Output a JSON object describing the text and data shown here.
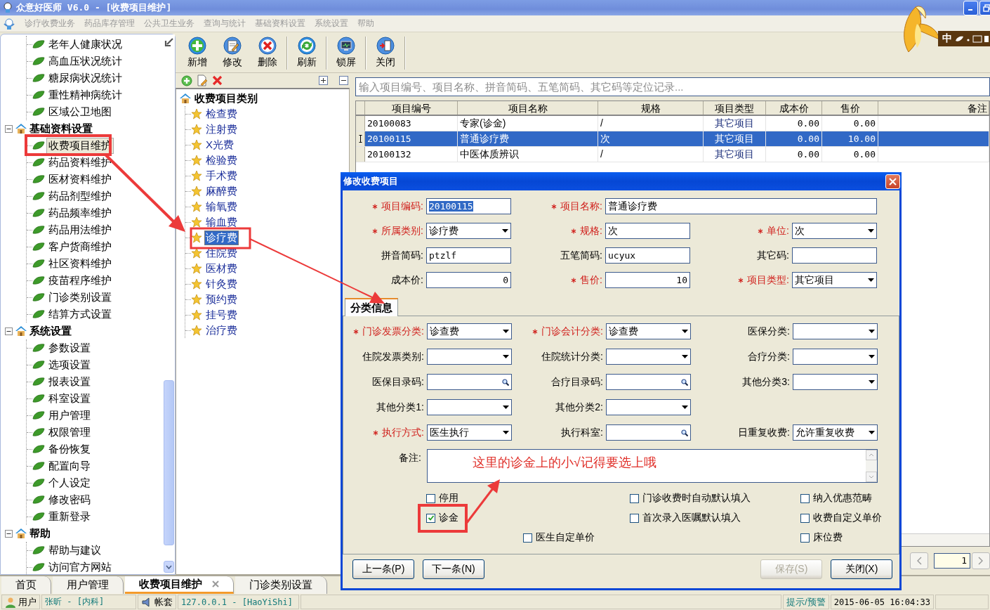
{
  "window": {
    "title": "众意好医师 V6.0 - [收费项目维护]"
  },
  "menu": [
    {
      "label": "诊疗收费业务",
      "disabled": true
    },
    {
      "label": "药品库存管理",
      "disabled": true
    },
    {
      "label": "公共卫生业务",
      "disabled": true
    },
    {
      "label": "查询与统计",
      "disabled": true
    },
    {
      "label": "基础资料设置",
      "disabled": true
    },
    {
      "label": "系统设置",
      "disabled": true
    },
    {
      "label": "帮助",
      "disabled": true
    }
  ],
  "ime": {
    "label": "中"
  },
  "nav_tree": {
    "items": [
      {
        "label": "老年人健康状况",
        "selected": false
      },
      {
        "label": "高血压状况统计",
        "selected": false
      },
      {
        "label": "糖尿病状况统计",
        "selected": false
      },
      {
        "label": "重性精神病统计",
        "selected": false
      },
      {
        "label": "区域公卫地图",
        "selected": false
      }
    ],
    "groups": [
      {
        "label": "基础资料设置",
        "expanded": true,
        "children": [
          {
            "label": "收费项目维护",
            "selected": true
          },
          {
            "label": "药品资料维护",
            "selected": false
          },
          {
            "label": "医材资料维护",
            "selected": false
          },
          {
            "label": "药品剂型维护",
            "selected": false
          },
          {
            "label": "药品频率维护",
            "selected": false
          },
          {
            "label": "药品用法维护",
            "selected": false
          },
          {
            "label": "客户货商维护",
            "selected": false
          },
          {
            "label": "社区资料维护",
            "selected": false
          },
          {
            "label": "疫苗程序维护",
            "selected": false
          },
          {
            "label": "门诊类别设置",
            "selected": false
          },
          {
            "label": "结算方式设置",
            "selected": false
          }
        ]
      },
      {
        "label": "系统设置",
        "expanded": true,
        "children": [
          {
            "label": "参数设置",
            "selected": false
          },
          {
            "label": "选项设置",
            "selected": false
          },
          {
            "label": "报表设置",
            "selected": false
          },
          {
            "label": "科室设置",
            "selected": false
          },
          {
            "label": "用户管理",
            "selected": false
          },
          {
            "label": "权限管理",
            "selected": false
          },
          {
            "label": "备份恢复",
            "selected": false
          },
          {
            "label": "配置向导",
            "selected": false
          },
          {
            "label": "个人设定",
            "selected": false
          },
          {
            "label": "修改密码",
            "selected": false
          },
          {
            "label": "重新登录",
            "selected": false
          }
        ]
      },
      {
        "label": "帮助",
        "expanded": true,
        "children": [
          {
            "label": "帮助与建议",
            "selected": false
          },
          {
            "label": "访问官方网站",
            "selected": false
          }
        ]
      }
    ]
  },
  "toolbar": [
    {
      "label": "新增",
      "kind": "add"
    },
    {
      "label": "修改",
      "kind": "edit"
    },
    {
      "label": "删除",
      "kind": "delete"
    },
    {
      "label": "刷新",
      "kind": "refresh"
    },
    {
      "label": "锁屏",
      "kind": "lock"
    },
    {
      "label": "关闭",
      "kind": "close"
    }
  ],
  "category_tree": {
    "root": "收费项目类别",
    "children": [
      {
        "label": "检查费",
        "selected": false
      },
      {
        "label": "注射费",
        "selected": false
      },
      {
        "label": "X光费",
        "selected": false
      },
      {
        "label": "检验费",
        "selected": false
      },
      {
        "label": "手术费",
        "selected": false
      },
      {
        "label": "麻醉费",
        "selected": false
      },
      {
        "label": "输氧费",
        "selected": false
      },
      {
        "label": "输血费",
        "selected": false
      },
      {
        "label": "诊疗费",
        "selected": true
      },
      {
        "label": "住院费",
        "selected": false
      },
      {
        "label": "医材费",
        "selected": false
      },
      {
        "label": "针灸费",
        "selected": false
      },
      {
        "label": "预约费",
        "selected": false
      },
      {
        "label": "挂号费",
        "selected": false
      },
      {
        "label": "治疗费",
        "selected": false
      }
    ]
  },
  "search": {
    "placeholder": "输入项目编号、项目名称、拼音简码、五笔简码、其它码等定位记录..."
  },
  "table": {
    "columns": [
      "项目编号",
      "项目名称",
      "规格",
      "项目类型",
      "成本价",
      "售价",
      "备注"
    ],
    "rows": [
      {
        "selected": false,
        "cells": [
          "20100083",
          "专家(诊金)",
          "/",
          "其它项目",
          "0.00",
          "0.00"
        ]
      },
      {
        "selected": true,
        "cells": [
          "20100115",
          "普通诊疗费",
          "次",
          "其它项目",
          "0.00",
          "10.00"
        ]
      },
      {
        "selected": false,
        "cells": [
          "20100132",
          "中医体质辨识",
          "/",
          "其它项目",
          "0.00",
          "0.00"
        ]
      }
    ]
  },
  "pager": {
    "page": "1"
  },
  "dialog": {
    "title": "修改收费项目",
    "fields": [
      [
        {
          "label": "项目编码:",
          "required": true,
          "kind": "text",
          "value": "20100115",
          "value_selected": true
        },
        {
          "label": "项目名称:",
          "required": true,
          "kind": "text",
          "value": "普通诊疗费",
          "value_selected": false
        }
      ],
      [
        {
          "label": "所属类别:",
          "required": true,
          "kind": "select",
          "value": "诊疗费"
        },
        {
          "label": "规格:",
          "required": true,
          "kind": "text",
          "value": "次"
        },
        {
          "label": "单位:",
          "required": true,
          "kind": "select",
          "value": "次"
        }
      ],
      [
        {
          "label": "拼音简码:",
          "required": false,
          "kind": "text",
          "value": "ptzlf"
        },
        {
          "label": "五笔简码:",
          "required": false,
          "kind": "text",
          "value": "ucyux"
        },
        {
          "label": "其它码:",
          "required": false,
          "kind": "text"
        }
      ],
      [
        {
          "label": "成本价:",
          "required": false,
          "kind": "number",
          "value": "0"
        },
        {
          "label": "售价:",
          "required": true,
          "kind": "number",
          "value": "10"
        },
        {
          "label": "项目类型:",
          "required": true,
          "kind": "select",
          "value": "其它项目"
        }
      ]
    ],
    "tab": {
      "label": "分类信息",
      "selected": true
    },
    "category_fields": [
      [
        {
          "label": "门诊发票分类:",
          "required": true,
          "kind": "select",
          "value": "诊查费"
        },
        {
          "label": "门诊会计分类:",
          "required": true,
          "kind": "select",
          "value": "诊查费"
        },
        {
          "label": "医保分类:",
          "required": false,
          "kind": "select"
        }
      ],
      [
        {
          "label": "住院发票类别:",
          "required": false,
          "kind": "select"
        },
        {
          "label": "住院统计分类:",
          "required": false,
          "kind": "select"
        },
        {
          "label": "合疗分类:",
          "required": false,
          "kind": "select"
        }
      ],
      [
        {
          "label": "医保目录码:",
          "required": false,
          "kind": "lookup"
        },
        {
          "label": "合疗目录码:",
          "required": false,
          "kind": "lookup"
        },
        {
          "label": "其他分类3:",
          "required": false,
          "kind": "select"
        }
      ],
      [
        {
          "label": "其他分类1:",
          "required": false,
          "kind": "select"
        },
        {
          "label": "其他分类2:",
          "required": false,
          "kind": "select"
        }
      ],
      [
        {
          "label": "执行方式:",
          "required": true,
          "kind": "select",
          "value": "医生执行"
        },
        {
          "label": "执行科室:",
          "required": false,
          "kind": "lookup"
        },
        {
          "label": "日重复收费:",
          "required": false,
          "kind": "select",
          "value": "允许重复收费"
        }
      ]
    ],
    "remark": {
      "label": "备注:",
      "value": "这里的诊金上的小√记得要选上哦"
    },
    "checkboxes": [
      {
        "label": "停用",
        "checked": false
      },
      {
        "label": "门诊收费时自动默认填入",
        "checked": false
      },
      {
        "label": "纳入优惠范畴",
        "checked": false
      },
      {
        "label": "诊金",
        "checked": true
      },
      {
        "label": "首次录入医嘱默认填入",
        "checked": false
      },
      {
        "label": "收费自定义单价",
        "checked": false
      },
      {
        "label": "医生自定单价",
        "checked": false
      },
      {
        "label": "床位费",
        "checked": false
      }
    ],
    "buttons": [
      {
        "label": "上一条(P)",
        "disabled": false
      },
      {
        "label": "下一条(N)",
        "disabled": false
      },
      {
        "label": "保存(S)",
        "disabled": true
      },
      {
        "label": "关闭(X)",
        "disabled": false
      }
    ]
  },
  "bottom_tabs": [
    {
      "label": "首页",
      "selected": false,
      "closable": false
    },
    {
      "label": "用户管理",
      "selected": false,
      "closable": false
    },
    {
      "label": "收费项目维护",
      "selected": true,
      "closable": true
    },
    {
      "label": "门诊类别设置",
      "selected": false,
      "closable": false
    }
  ],
  "status_bar": {
    "user_label": "用户",
    "user": "张昕 - [内科]",
    "account_label": "帐套",
    "account": "127.0.0.1 - [HaoYiShi]",
    "alerts": "提示/预警",
    "datetime": "2015-06-05 16:04:33"
  }
}
